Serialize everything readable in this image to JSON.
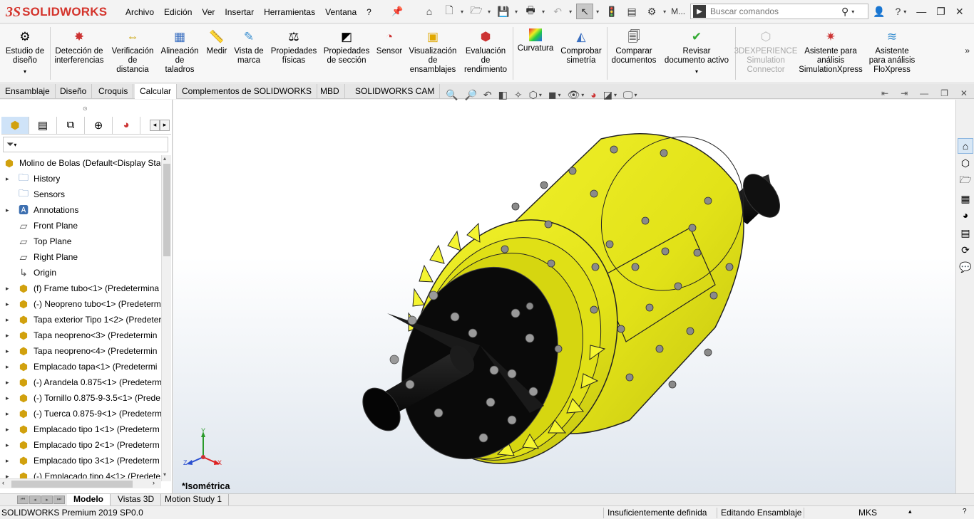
{
  "app": {
    "logo_ds": "3S",
    "logo_text": "SOLIDWORKS"
  },
  "menubar": {
    "items": [
      "Archivo",
      "Edición",
      "Ver",
      "Insertar",
      "Herramientas",
      "Ventana",
      "?"
    ],
    "toolbar_more_label": "M..."
  },
  "search": {
    "placeholder": "Buscar comandos"
  },
  "commands": [
    {
      "label": "Estudio de\ndiseño",
      "icon": "design-study-icon"
    },
    {
      "label": "Detección de\ninterferencias",
      "icon": "interference-detection-icon"
    },
    {
      "label": "Verificación\nde\ndistancia",
      "icon": "clearance-verification-icon"
    },
    {
      "label": "Alineación\nde\ntaladros",
      "icon": "hole-alignment-icon"
    },
    {
      "label": "Medir",
      "icon": "measure-icon"
    },
    {
      "label": "Vista de\nmarca",
      "icon": "markup-icon"
    },
    {
      "label": "Propiedades\nfísicas",
      "icon": "mass-properties-icon"
    },
    {
      "label": "Propiedades\nde sección",
      "icon": "section-properties-icon"
    },
    {
      "label": "Sensor",
      "icon": "sensor-icon"
    },
    {
      "label": "Visualización\nde\nensamblajes",
      "icon": "assembly-visualization-icon"
    },
    {
      "label": "Evaluación\nde\nrendimiento",
      "icon": "performance-evaluation-icon"
    },
    {
      "label": "Curvatura",
      "icon": "curvature-icon"
    },
    {
      "label": "Comprobar\nsimetría",
      "icon": "symmetry-check-icon"
    },
    {
      "label": "Comparar\ndocumentos",
      "icon": "compare-documents-icon"
    },
    {
      "label": "Revisar\ndocumento activo",
      "icon": "check-active-document-icon"
    },
    {
      "label": "3DEXPERIENCE\nSimulation\nConnector",
      "icon": "3dexperience-icon",
      "disabled": true
    },
    {
      "label": "Asistente para\nanálisis\nSimulationXpress",
      "icon": "simulationxpress-icon"
    },
    {
      "label": "Asistente\npara análisis\nFloXpress",
      "icon": "floxpress-icon"
    }
  ],
  "tabs": [
    "Ensamblaje",
    "Diseño",
    "Croquis",
    "Calcular",
    "Complementos de SOLIDWORKS",
    "MBD",
    "SOLIDWORKS CAM"
  ],
  "active_tab": "Calcular",
  "tree": {
    "root": "Molino de Bolas  (Default<Display Sta",
    "items": [
      {
        "label": "History",
        "icon": "history-folder-icon",
        "expand": true
      },
      {
        "label": "Sensors",
        "icon": "sensors-folder-icon",
        "expand": false
      },
      {
        "label": "Annotations",
        "icon": "annotations-folder-icon",
        "expand": true
      },
      {
        "label": "Front Plane",
        "icon": "plane-icon",
        "expand": false
      },
      {
        "label": "Top Plane",
        "icon": "plane-icon",
        "expand": false
      },
      {
        "label": "Right Plane",
        "icon": "plane-icon",
        "expand": false
      },
      {
        "label": "Origin",
        "icon": "origin-icon",
        "expand": false
      },
      {
        "label": "(f) Frame tubo<1> (Predetermina",
        "icon": "component-icon",
        "expand": true
      },
      {
        "label": "(-) Neopreno tubo<1> (Predeterm",
        "icon": "component-icon",
        "expand": true
      },
      {
        "label": "Tapa exterior Tipo 1<2> (Predeter",
        "icon": "component-icon",
        "expand": true
      },
      {
        "label": "Tapa neopreno<3> (Predetermin",
        "icon": "component-icon",
        "expand": true
      },
      {
        "label": "Tapa neopreno<4> (Predetermin",
        "icon": "component-icon",
        "expand": true
      },
      {
        "label": "Emplacado tapa<1> (Predetermi",
        "icon": "component-icon",
        "expand": true
      },
      {
        "label": "(-) Arandela 0.875<1> (Predeterm",
        "icon": "component-icon",
        "expand": true
      },
      {
        "label": "(-) Tornillo 0.875-9-3.5<1> (Prede",
        "icon": "component-icon",
        "expand": true
      },
      {
        "label": "(-) Tuerca 0.875-9<1> (Predeterm",
        "icon": "component-icon",
        "expand": true
      },
      {
        "label": "Emplacado tipo 1<1> (Predeterm",
        "icon": "component-icon",
        "expand": true
      },
      {
        "label": "Emplacado tipo 2<1> (Predeterm",
        "icon": "component-icon",
        "expand": true
      },
      {
        "label": "Emplacado tipo 3<1> (Predeterm",
        "icon": "component-icon",
        "expand": true
      },
      {
        "label": "(-) Emplacado tipo 4<1> (Predete",
        "icon": "component-icon",
        "expand": true
      }
    ]
  },
  "viewport": {
    "view_name": "*Isométrica",
    "triad": {
      "x": "X",
      "y": "Y",
      "z": "Z"
    }
  },
  "bottom_tabs": [
    "Modelo",
    "Vistas 3D",
    "Motion Study 1"
  ],
  "active_bottom_tab": "Modelo",
  "status": {
    "product": "SOLIDWORKS Premium 2019 SP0.0",
    "definition": "Insuficientemente definida",
    "mode": "Editando Ensamblaje",
    "units": "MKS"
  },
  "colors": {
    "part_yellow": "#e6e619",
    "shaft_black": "#0c0c0c",
    "logo_red": "#d4342c",
    "accent_blue": "#3a7fd0"
  }
}
